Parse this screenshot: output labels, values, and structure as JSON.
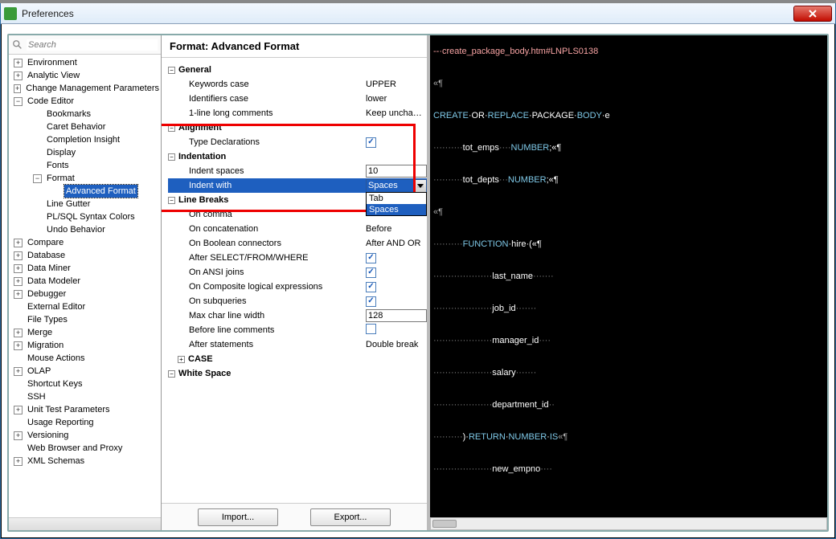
{
  "titlebar": {
    "title": "Preferences"
  },
  "search": {
    "placeholder": "Search"
  },
  "tree": [
    {
      "exp": "+",
      "lvl": 0,
      "label": "Environment"
    },
    {
      "exp": "+",
      "lvl": 0,
      "label": "Analytic View"
    },
    {
      "exp": "+",
      "lvl": 0,
      "label": "Change Management Parameters"
    },
    {
      "exp": "-",
      "lvl": 0,
      "label": "Code Editor"
    },
    {
      "exp": "",
      "lvl": 1,
      "label": "Bookmarks"
    },
    {
      "exp": "",
      "lvl": 1,
      "label": "Caret Behavior"
    },
    {
      "exp": "",
      "lvl": 1,
      "label": "Completion Insight"
    },
    {
      "exp": "",
      "lvl": 1,
      "label": "Display"
    },
    {
      "exp": "",
      "lvl": 1,
      "label": "Fonts"
    },
    {
      "exp": "-",
      "lvl": 1,
      "label": "Format"
    },
    {
      "exp": "",
      "lvl": 2,
      "label": "Advanced Format",
      "selected": true
    },
    {
      "exp": "",
      "lvl": 1,
      "label": "Line Gutter"
    },
    {
      "exp": "",
      "lvl": 1,
      "label": "PL/SQL Syntax Colors"
    },
    {
      "exp": "",
      "lvl": 1,
      "label": "Undo Behavior"
    },
    {
      "exp": "+",
      "lvl": 0,
      "label": "Compare"
    },
    {
      "exp": "+",
      "lvl": 0,
      "label": "Database"
    },
    {
      "exp": "+",
      "lvl": 0,
      "label": "Data Miner"
    },
    {
      "exp": "+",
      "lvl": 0,
      "label": "Data Modeler"
    },
    {
      "exp": "+",
      "lvl": 0,
      "label": "Debugger"
    },
    {
      "exp": "",
      "lvl": 0,
      "label": "External Editor"
    },
    {
      "exp": "",
      "lvl": 0,
      "label": "File Types"
    },
    {
      "exp": "+",
      "lvl": 0,
      "label": "Merge"
    },
    {
      "exp": "+",
      "lvl": 0,
      "label": "Migration"
    },
    {
      "exp": "",
      "lvl": 0,
      "label": "Mouse Actions"
    },
    {
      "exp": "+",
      "lvl": 0,
      "label": "OLAP"
    },
    {
      "exp": "",
      "lvl": 0,
      "label": "Shortcut Keys"
    },
    {
      "exp": "",
      "lvl": 0,
      "label": "SSH"
    },
    {
      "exp": "+",
      "lvl": 0,
      "label": "Unit Test Parameters"
    },
    {
      "exp": "",
      "lvl": 0,
      "label": "Usage Reporting"
    },
    {
      "exp": "+",
      "lvl": 0,
      "label": "Versioning"
    },
    {
      "exp": "",
      "lvl": 0,
      "label": "Web Browser and Proxy"
    },
    {
      "exp": "+",
      "lvl": 0,
      "label": "XML Schemas"
    }
  ],
  "mid": {
    "title": "Format: Advanced Format",
    "groups": {
      "general": "General",
      "alignment": "Alignment",
      "indentation": "Indentation",
      "linebreaks": "Line Breaks",
      "case": "CASE",
      "whitespace": "White Space"
    },
    "rows": {
      "keywords_case": {
        "label": "Keywords case",
        "value": "UPPER"
      },
      "identifiers_case": {
        "label": "Identifiers case",
        "value": "lower"
      },
      "one_line": {
        "label": "1-line long comments",
        "value": "Keep uncha…"
      },
      "type_decl": {
        "label": "Type Declarations",
        "checked": true
      },
      "indent_spaces": {
        "label": "Indent spaces",
        "value": "10"
      },
      "indent_with": {
        "label": "Indent with",
        "value": "Spaces",
        "options": [
          "Tab",
          "Spaces"
        ]
      },
      "on_comma": {
        "label": "On comma",
        "value": ""
      },
      "on_concat": {
        "label": "On concatenation",
        "value": "Before"
      },
      "on_bool": {
        "label": "On Boolean connectors",
        "value": "After AND OR"
      },
      "after_sfw": {
        "label": "After SELECT/FROM/WHERE",
        "checked": true
      },
      "on_ansi": {
        "label": "On ANSI joins",
        "checked": true
      },
      "on_composite": {
        "label": "On Composite logical expressions",
        "checked": true
      },
      "on_subq": {
        "label": "On subqueries",
        "checked": true
      },
      "max_width": {
        "label": "Max char line width",
        "value": "128"
      },
      "before_line": {
        "label": "Before line comments",
        "checked": false
      },
      "after_stmt": {
        "label": "After statements",
        "value": "Double break"
      }
    }
  },
  "footer": {
    "import": "Import...",
    "export": "Export..."
  },
  "preview": {
    "dots2": "··",
    "dots4": "····",
    "dots7": "·······",
    "dots10": "··········",
    "dots20": "····················",
    "l1_a": "--",
    "l1_b": "·create_package_body.htm#LNPLS0138",
    "l2": "«¶",
    "l3_a": "CREATE",
    "l3_b": "·OR·",
    "l3_c": "REPLACE",
    "l3_d": "·PACKAGE·",
    "l3_e": "BODY",
    "l3_f": "·e",
    "l4_a": "tot_emps",
    "l4_b": "NUMBER",
    "l4_c": ";«¶",
    "l5_a": "tot_depts",
    "l5_b": "NUMBER",
    "l5_c": ";«¶",
    "l6": "«¶",
    "l7_a": "FUNCTION",
    "l7_b": "·hire·(«¶",
    "l8": "last_name",
    "l9": "job_id",
    "l10": "manager_id",
    "l11": "salary",
    "l12": "department_id",
    "l13_a": ")·",
    "l13_b": "RETURN",
    "l13_c": "·",
    "l13_d": "NUMBER",
    "l13_e": "·",
    "l13_f": "IS",
    "l13_g": "«¶",
    "l14": "new_empno"
  }
}
